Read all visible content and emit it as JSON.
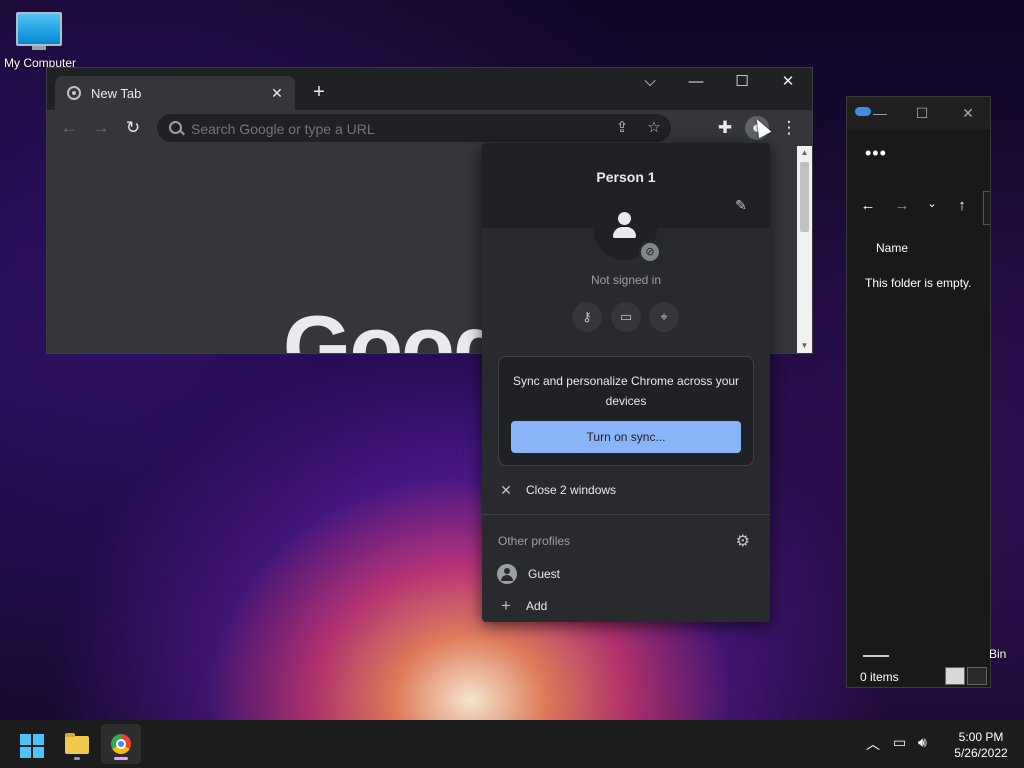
{
  "desktop": {
    "icons": [
      {
        "label": "My Computer",
        "icon": "monitor-icon"
      }
    ],
    "recycle_bin_fragment": "Bin"
  },
  "chrome": {
    "tab_title": "New Tab",
    "window_controls": {
      "tab_search": "⌵",
      "minimize": "—",
      "maximize": "☐",
      "close": "✕"
    },
    "omnibox_placeholder": "Search Google or type a URL",
    "ntp_logo_fragment": "Goog"
  },
  "profile_menu": {
    "name": "Person 1",
    "status": "Not signed in",
    "quick_buttons": [
      "key-icon",
      "credit-card-icon",
      "location-pin-icon"
    ],
    "sync_text": "Sync and personalize Chrome across your devices",
    "sync_button": "Turn on sync...",
    "close_windows": "Close 2 windows",
    "other_profiles_label": "Other profiles",
    "guest_label": "Guest",
    "add_label": "Add"
  },
  "explorer": {
    "column_name": "Name",
    "empty_message": "This folder is empty.",
    "items_count": "0 items"
  },
  "taskbar": {
    "time": "5:00 PM",
    "date": "5/26/2022"
  },
  "colors": {
    "chrome_bg": "#202124",
    "chrome_toolbar": "#35363a",
    "accent_blue": "#8ab4f8",
    "taskbar_bg": "#1c1c1c"
  }
}
